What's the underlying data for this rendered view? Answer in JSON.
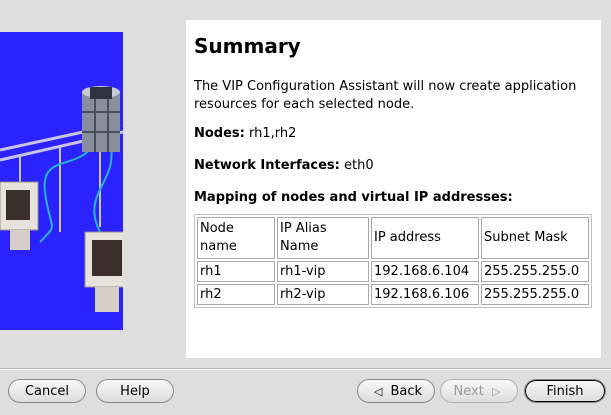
{
  "summary": {
    "title": "Summary",
    "intro": "The VIP Configuration Assistant will now create application resources for each selected node.",
    "nodes_label": "Nodes:",
    "nodes_value": "rh1,rh2",
    "interfaces_label": "Network Interfaces:",
    "interfaces_value": "eth0",
    "mapping_heading": "Mapping of nodes and virtual IP addresses:"
  },
  "table": {
    "headers": [
      "Node name",
      "IP Alias Name",
      "IP address",
      "Subnet Mask"
    ],
    "rows": [
      [
        "rh1",
        "rh1-vip",
        "192.168.6.104",
        "255.255.255.0"
      ],
      [
        "rh2",
        "rh2-vip",
        "192.168.6.106",
        "255.255.255.0"
      ]
    ]
  },
  "buttons": {
    "cancel": "Cancel",
    "help": "Help",
    "back": "Back",
    "next": "Next",
    "finish": "Finish"
  },
  "colors": {
    "illustration_blue": "#2a22ff",
    "panel": "#ffffff",
    "dialog_bg": "#dedede"
  }
}
